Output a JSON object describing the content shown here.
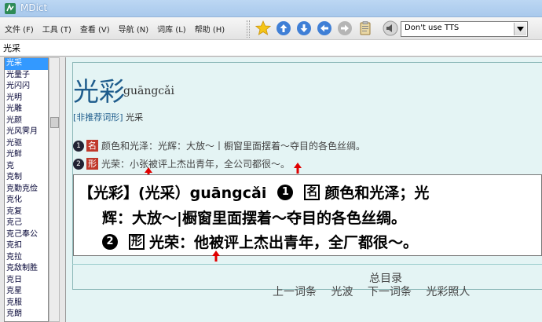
{
  "window": {
    "title": "MDict"
  },
  "menu": [
    "文件 (F)",
    "工具 (T)",
    "查看 (V)",
    "导航 (N)",
    "词库 (L)",
    "帮助 (H)"
  ],
  "toolbar": {
    "icons": [
      "star-icon",
      "up-icon",
      "down-icon",
      "back-icon",
      "forward-icon",
      "clipboard-icon",
      "speaker-icon"
    ],
    "tts_value": "Don't use TTS"
  },
  "search": {
    "value": "光采"
  },
  "wordlist": [
    "光采",
    "光量子",
    "光闪闪",
    "光明",
    "光雕",
    "光颜",
    "光风霁月",
    "光驱",
    "光鲜",
    "克",
    "克制",
    "克勤克俭",
    "克化",
    "克复",
    "克己",
    "克己奉公",
    "克扣",
    "克拉",
    "克敌制胜",
    "克日",
    "克星",
    "克服",
    "克朗"
  ],
  "entry": {
    "headword": "光彩",
    "pinyin": "guāngcǎi",
    "variant_tag": "[非推荐词形]",
    "variant_word": "光采",
    "senses": [
      {
        "num": "1",
        "pos": "名",
        "text": "颜色和光泽：光辉：大放～丨橱窗里面摆着～夺目的各色丝绸。"
      },
      {
        "num": "2",
        "pos": "形",
        "text": "光荣：小张被评上杰出青年，全公司都很～。"
      }
    ]
  },
  "print_image": {
    "line1_head": "【光彩】(光采）guāngcǎi",
    "line1_num": "1",
    "line1_pos": "名",
    "line1_text": "颜色和光泽；光",
    "line2_text": "辉：大放～|橱窗里面摆着～夺目的各色丝绸。",
    "line3_num": "2",
    "line3_pos": "形",
    "line3_text": "光荣：他被评上杰出青年，全厂都很～。"
  },
  "footer": {
    "title": "总目录",
    "links": [
      "上一词条",
      "光波",
      "下一词条",
      "光彩照人"
    ]
  },
  "colors": {
    "selection": "#3399ff",
    "content_bg": "#e4f4f4",
    "headword": "#1e5c8c",
    "pos_tag": "#c0392b",
    "arrow": "#e00000"
  }
}
